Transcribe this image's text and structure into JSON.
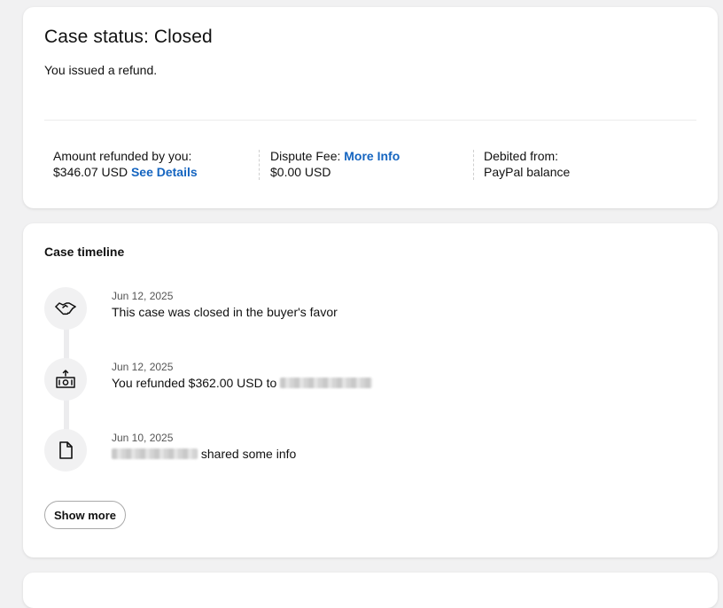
{
  "status": {
    "title": "Case status: Closed",
    "subtitle": "You issued a refund."
  },
  "details": {
    "refund_label": "Amount refunded by you:",
    "refund_value": "$346.07 USD",
    "refund_link": "See Details",
    "fee_label": "Dispute Fee:",
    "fee_link": "More Info",
    "fee_value": "$0.00 USD",
    "debit_label": "Debited from:",
    "debit_value": "PayPal balance"
  },
  "timeline": {
    "title": "Case timeline",
    "items": [
      {
        "icon": "handshake-icon",
        "date": "Jun 12, 2025",
        "text": "This case was closed in the buyer's favor"
      },
      {
        "icon": "money-send-icon",
        "date": "Jun 12, 2025",
        "text": "You refunded $362.00 USD to"
      },
      {
        "icon": "document-icon",
        "date": "Jun 10, 2025",
        "text": "shared some info"
      }
    ],
    "show_more": "Show more"
  },
  "colors": {
    "link": "#1565c0",
    "background": "#f1f1f2"
  }
}
